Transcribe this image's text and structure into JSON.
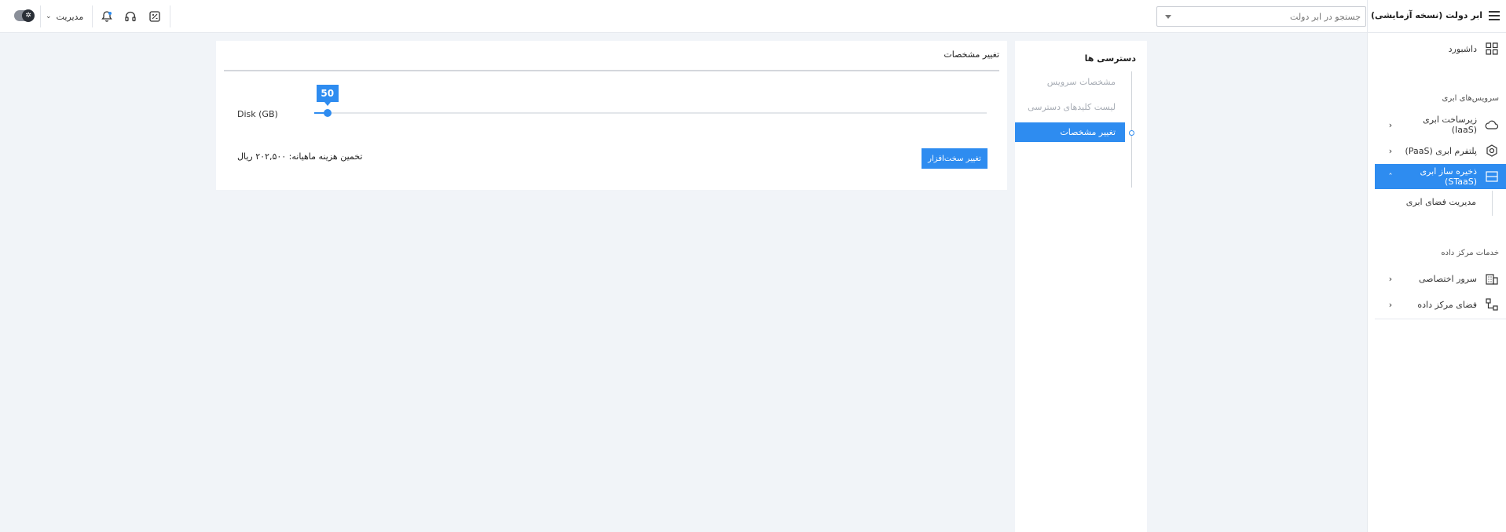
{
  "header": {
    "search_placeholder": "جستجو در ابر دولت",
    "admin_label": "مدیریت",
    "icons": [
      "theme-toggle-icon",
      "notification-bell-icon",
      "headset-support-icon",
      "calculator-icon"
    ]
  },
  "sidebar": {
    "brand_title": "ابر دولت (نسخه آزمایشی)",
    "dashboard_label": "داشبورد",
    "cloud_services_heading": "سرویس‌های ابری",
    "iaas_label": "زیرساخت ابری (IaaS)",
    "paas_label": "پلتفرم ابری (PaaS)",
    "staas_label": "ذخیره ساز ابری (STaaS)",
    "staas_sub_label": "مدیریت فضای ابری",
    "datacenter_heading": "خدمات مرکز داده",
    "dedicated_server_label": "سرور اختصاصی",
    "datacenter_space_label": "فضای مرکز داده"
  },
  "access_panel": {
    "title": "دسترسی ها",
    "items": [
      "مشخصات سرویس",
      "لیست کلیدهای دسترسی",
      "تغییر مشخصات"
    ]
  },
  "main": {
    "title": "تغییر مشخصات",
    "disk_label": "Disk (GB)",
    "disk_value": "50",
    "disk_min": 0,
    "disk_max": 2560,
    "cost_text": "تخمین هزینه ماهیانه: ۲۰۲,۵۰۰ ریال",
    "change_hardware_button": "تغییر سخت‌افزار"
  },
  "colors": {
    "accent": "#2e8cf0",
    "background": "#f1f4f8"
  }
}
